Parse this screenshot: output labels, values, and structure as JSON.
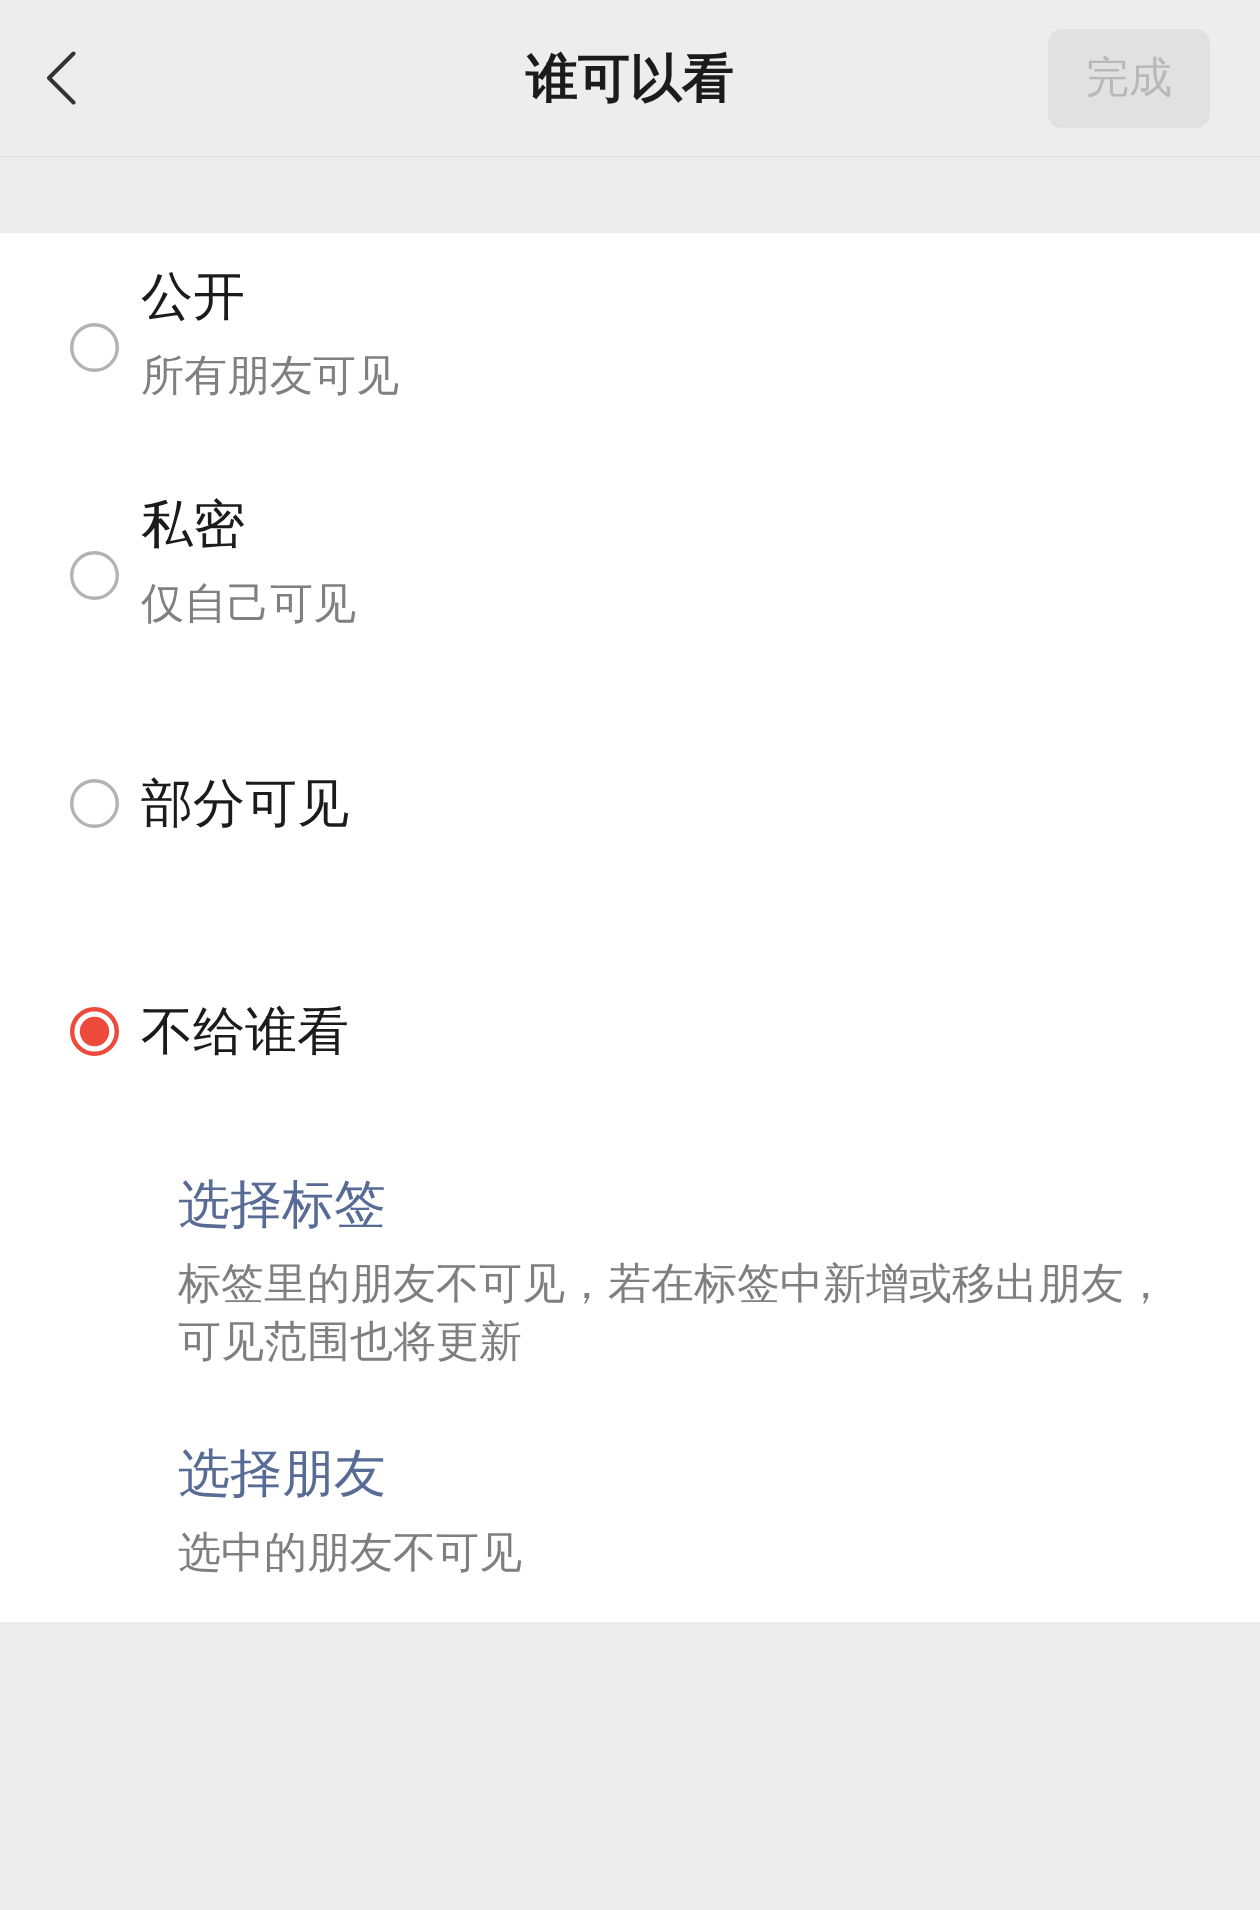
{
  "header": {
    "title": "谁可以看",
    "done_button": {
      "label": "完成",
      "disabled": true
    }
  },
  "options": [
    {
      "title": "公开",
      "subtitle": "所有朋友可见",
      "selected": false
    },
    {
      "title": "私密",
      "subtitle": "仅自己可见",
      "selected": false
    },
    {
      "title": "部分可见",
      "selected": false
    },
    {
      "title": "不给谁看",
      "selected": true,
      "sub_options": [
        {
          "label": "选择标签",
          "description": "标签里的朋友不可见，若在标签中新增或移出朋友，可见范围也将更新"
        },
        {
          "label": "选择朋友",
          "description": "选中的朋友不可见"
        }
      ]
    }
  ]
}
